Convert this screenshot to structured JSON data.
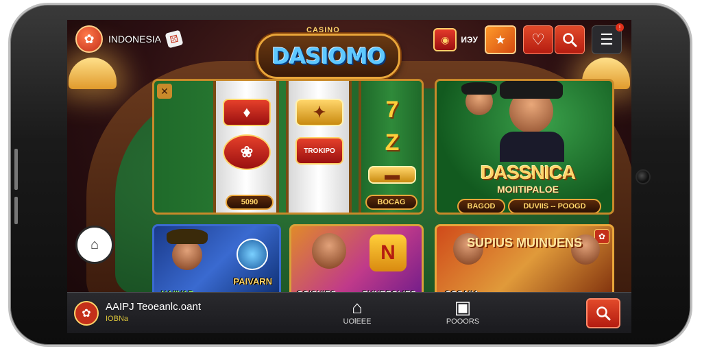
{
  "topbar": {
    "lang_label": "INDONESIA",
    "coin_text": "ИЭУ"
  },
  "brand": {
    "small_text": "CASINO",
    "name": "DASIOMO"
  },
  "slot_card": {
    "symbol_text": "TROKIPO",
    "left_pill": "5090",
    "right_pill": "BOCAG"
  },
  "host_card": {
    "title": "DASSNICA",
    "subtitle": "MOIITIPALOE",
    "pill_left": "BAGOD",
    "pill_right": "DUVIIS -- POOGD"
  },
  "mini_cards": [
    {
      "label": "PAIVARN",
      "sub_label": "NAIIVAP"
    },
    {
      "label": "COISNIES",
      "sub_label": "PUNRPOLIES"
    },
    {
      "label": "SUPIUS MUINUENS",
      "sub_label": "COSAIIA"
    }
  ],
  "bottom_bar": {
    "app_name": "AAIPJ Teoeanlc.oant",
    "app_sub": "IOBNa",
    "home_label": "UOlEEE",
    "promo_label": "POOORS"
  },
  "icons": {
    "search": "search-icon",
    "menu": "menu-icon",
    "home": "home-icon"
  },
  "colors": {
    "accent": "#e24a2a",
    "gold": "#e9a63a",
    "felt": "#2a7d34"
  }
}
